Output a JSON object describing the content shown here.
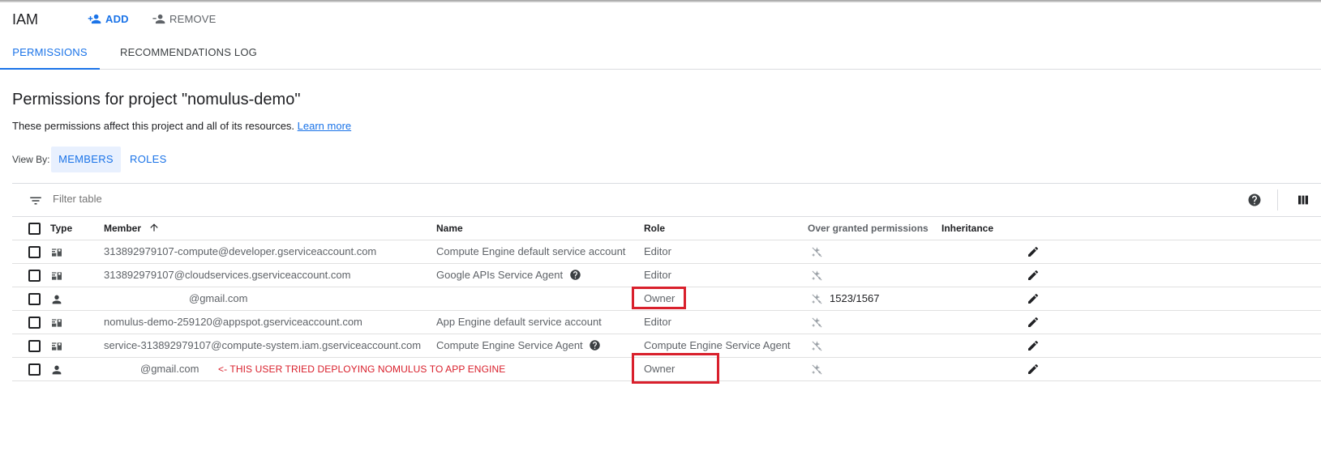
{
  "header": {
    "title": "IAM",
    "add_label": "ADD",
    "remove_label": "REMOVE"
  },
  "tabs": [
    {
      "label": "PERMISSIONS",
      "active": true
    },
    {
      "label": "RECOMMENDATIONS LOG",
      "active": false
    }
  ],
  "page": {
    "title": "Permissions for project \"nomulus-demo\"",
    "subtitle": "These permissions affect this project and all of its resources.",
    "learn_more": "Learn more"
  },
  "view_by": {
    "label": "View By:",
    "options": [
      "MEMBERS",
      "ROLES"
    ],
    "selected": "MEMBERS"
  },
  "filter": {
    "placeholder": "Filter table"
  },
  "table": {
    "columns": [
      "Type",
      "Member",
      "Name",
      "Role",
      "Over granted permissions",
      "Inheritance"
    ],
    "rows": [
      {
        "type": "service-account",
        "member": "313892979107-compute@developer.gserviceaccount.com",
        "name": "Compute Engine default service account",
        "role": "Editor",
        "over": "",
        "help": false
      },
      {
        "type": "service-account",
        "member": "313892979107@cloudservices.gserviceaccount.com",
        "name": "Google APIs Service Agent",
        "role": "Editor",
        "over": "",
        "help": true
      },
      {
        "type": "user",
        "member": "@gmail.com",
        "name": "",
        "role": "Owner",
        "over": "1523/1567",
        "help": false
      },
      {
        "type": "service-account",
        "member": "nomulus-demo-259120@appspot.gserviceaccount.com",
        "name": "App Engine default service account",
        "role": "Editor",
        "over": "",
        "help": false
      },
      {
        "type": "service-account",
        "member": "service-313892979107@compute-system.iam.gserviceaccount.com",
        "name": "Compute Engine Service Agent",
        "role": "Compute Engine Service Agent",
        "over": "",
        "help": true
      },
      {
        "type": "user",
        "member": "@gmail.com",
        "name": "",
        "role": "Owner",
        "over": "",
        "help": false
      }
    ]
  },
  "annotation": {
    "text": "<- THIS USER TRIED DEPLOYING NOMULUS TO APP ENGINE",
    "color": "#d9202c"
  },
  "colors": {
    "accent": "#1a73e8",
    "text": "#202124",
    "muted": "#5f6368",
    "annotation": "#d9202c"
  }
}
